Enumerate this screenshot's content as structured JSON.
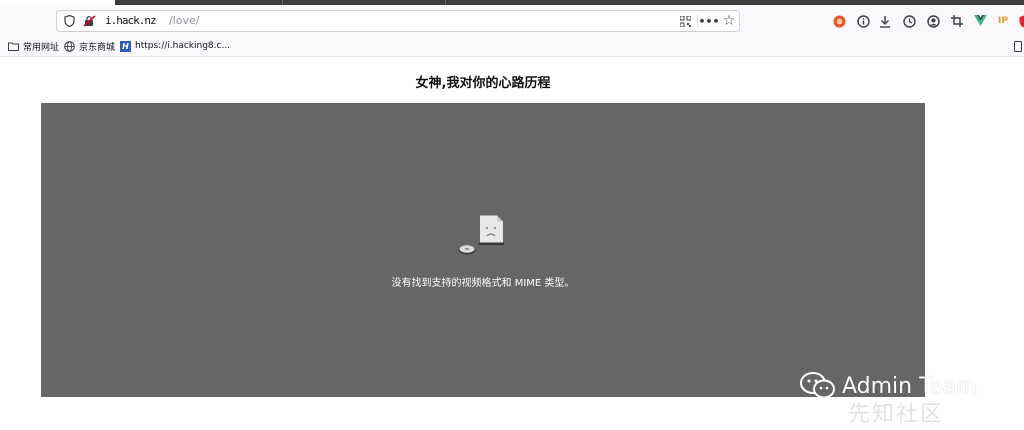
{
  "browser": {
    "url_host": "i.hack.nz",
    "url_path": "/love/",
    "bookmarks": [
      {
        "label": "常用网址",
        "icon": "folder-icon"
      },
      {
        "label": "京东商城",
        "icon": "globe-icon"
      },
      {
        "label": "https://i.hacking8.c...",
        "icon": "hacking8-icon"
      }
    ],
    "extensions": [
      "pwn-icon",
      "info-icon",
      "download-icon",
      "clock-icon",
      "account-icon",
      "crop-icon",
      "vue-icon",
      "ip-icon",
      "shield-icon"
    ],
    "ip_badge": "IP"
  },
  "page": {
    "heading": "女神,我对你的心路历程",
    "video_error": "没有找到支持的视频格式和 MIME 类型。"
  },
  "watermark": {
    "main": "Admin Team",
    "sub": "先知社区"
  },
  "colors": {
    "video_bg": "#666666",
    "toolbar_bg": "#f9f9fb"
  }
}
